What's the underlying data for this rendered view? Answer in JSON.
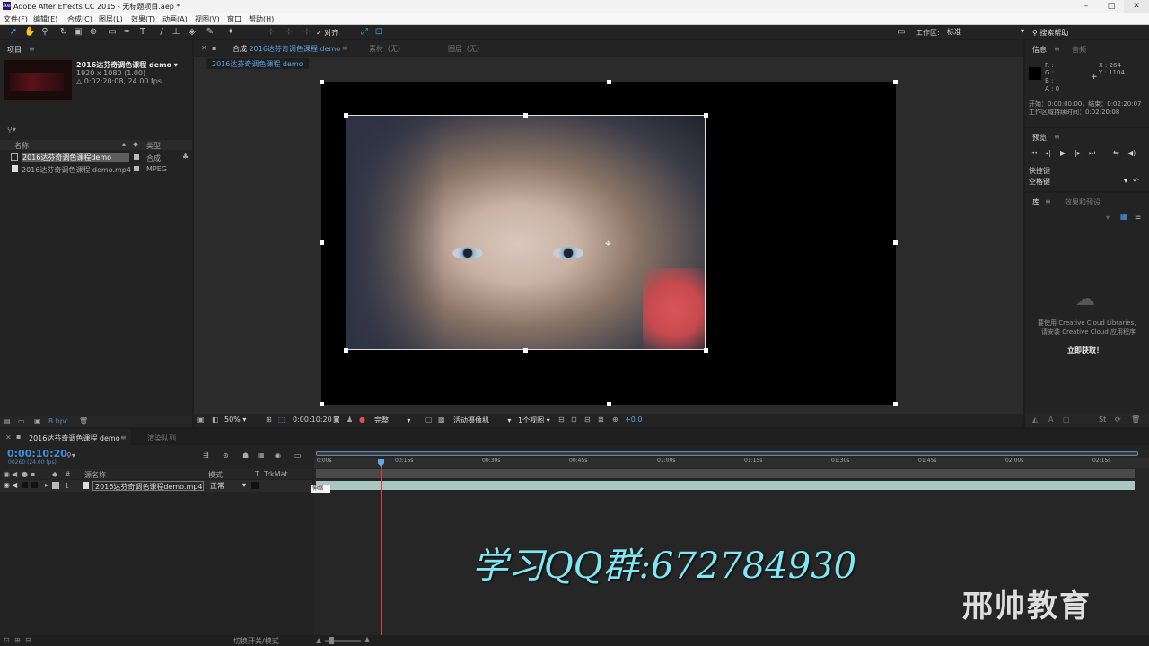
{
  "window": {
    "app_icon": "Ae",
    "title": "Adobe After Effects CC 2015 - 无标题项目.aep *",
    "controls": [
      "–",
      "□",
      "✕"
    ]
  },
  "menu": [
    "文件(F)",
    "编辑(E)",
    "合成(C)",
    "图层(L)",
    "效果(T)",
    "动画(A)",
    "视图(V)",
    "窗口",
    "帮助(H)"
  ],
  "toolbar": {
    "snap_label": "对齐",
    "workspace_label": "工作区:",
    "workspace_value": "标准",
    "search_help": "搜索帮助"
  },
  "project": {
    "tab": "项目",
    "comp_name": "2016达芬奇调色课程 demo ▾",
    "comp_size": "1920 x 1080 (1.00)",
    "comp_duration": "△ 0:02:20:08, 24.00 fps",
    "col_name": "名称",
    "col_type": "类型",
    "items": [
      {
        "name": "2016达芬奇调色课程demo",
        "type": "合成",
        "icon": "composition-icon"
      },
      {
        "name": "2016达芬奇调色课程 demo.mp4",
        "type": "MPEG",
        "icon": "footage-icon"
      }
    ],
    "bpc": "8 bpc"
  },
  "viewer": {
    "tab_comp_prefix": "合成",
    "tab_comp_name": "2016达芬奇调色课程 demo",
    "tab_footage": "素材（无）",
    "tab_layer": "图层（无）",
    "breadcrumb": "2016达芬奇调色课程 demo",
    "zoom": "50%",
    "timecode": "0:00:10:20",
    "quality": "完整",
    "camera": "活动摄像机",
    "views": "1个视图",
    "exposure": "+0.0"
  },
  "info": {
    "tab_info": "信息",
    "tab_audio": "音频",
    "r": "R :",
    "g": "G :",
    "b": "B :",
    "a": "A : 0",
    "x": "X : 264",
    "y": "Y : 1104",
    "start_end": "开始：0:00:00:00，结束：0:02:20:07",
    "duration": "工作区域持续时间：0:02:20:08"
  },
  "preview": {
    "tab": "预览",
    "shortcut_label": "快捷键",
    "shortcut_value": "空格键"
  },
  "library": {
    "tab_lib": "库",
    "tab_effects": "效果和预设",
    "cc_line1": "要使用 Creative Cloud Libraries,",
    "cc_line2": "请安装 Creative Cloud 应用程序",
    "cc_link": "立即获取！"
  },
  "timeline": {
    "tab_comp": "2016达芬奇调色课程 demo",
    "tab_render": "渲染队列",
    "timecode": "0:00:10:20",
    "frame_info": "00260 (24.00 fps)",
    "col_layer_name": "源名称",
    "col_mode": "模式",
    "col_t": "T",
    "col_trkmat": "TrkMat",
    "layer_index": "1",
    "layer_name": "2016达芬奇调色课程demo.mp4",
    "layer_mode": "正常",
    "tooltip": "伸缩",
    "ruler_labels": [
      "0:00s",
      "00:15s",
      "00:30s",
      "00:45s",
      "01:00s",
      "01:15s",
      "01:30s",
      "01:45s",
      "02:00s",
      "02:15s"
    ],
    "footer_toggle": "切换开关/模式"
  },
  "overlay": {
    "qq_group": "学习QQ群:672784930",
    "brand": "邢帅教育"
  },
  "colors": {
    "accent_blue": "#2d8ceb",
    "playhead": "#e03c3c",
    "layer_bar": "#a9c7c0",
    "watermark_cyan": "#7fe6f2"
  }
}
